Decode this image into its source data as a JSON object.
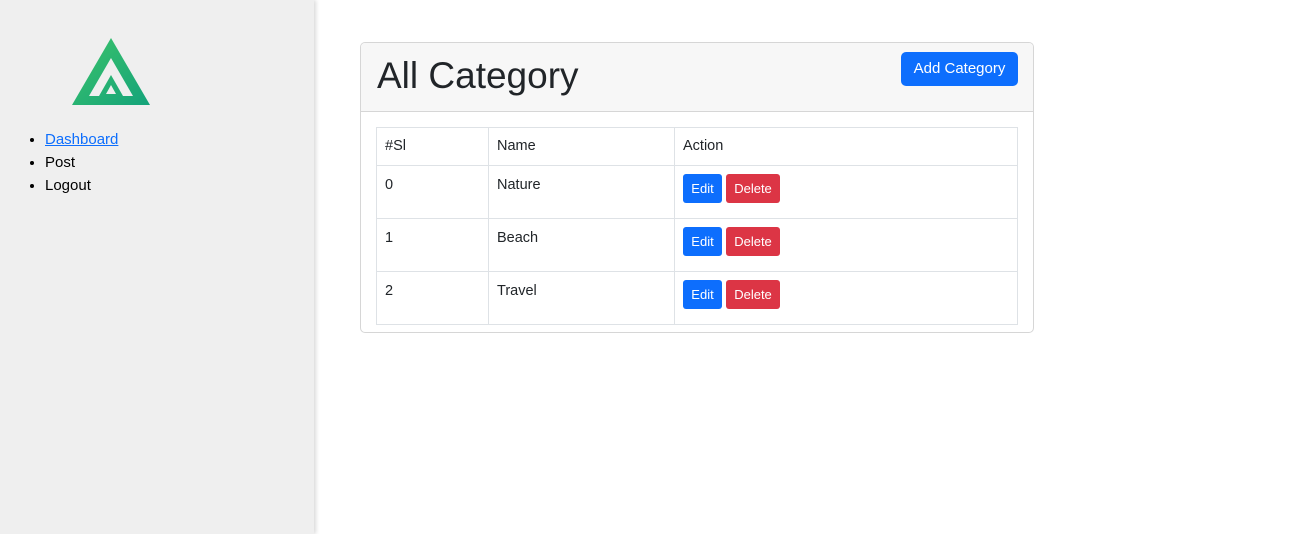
{
  "sidebar": {
    "logo_icon": "triangle-logo-icon",
    "nav": [
      {
        "label": "Dashboard",
        "link": true
      },
      {
        "label": "Post",
        "link": false
      },
      {
        "label": "Logout",
        "link": false
      }
    ]
  },
  "card": {
    "title": "All Category",
    "add_button": "Add Category"
  },
  "table": {
    "headers": [
      "#Sl",
      "Name",
      "Action"
    ],
    "rows": [
      {
        "sl": "0",
        "name": "Nature",
        "edit": "Edit",
        "delete": "Delete"
      },
      {
        "sl": "1",
        "name": "Beach",
        "edit": "Edit",
        "delete": "Delete"
      },
      {
        "sl": "2",
        "name": "Travel",
        "edit": "Edit",
        "delete": "Delete"
      }
    ]
  },
  "colors": {
    "primary": "#0d6efd",
    "danger": "#dc3545",
    "sidebar_bg": "#efefef",
    "logo_green": "#22b573"
  }
}
